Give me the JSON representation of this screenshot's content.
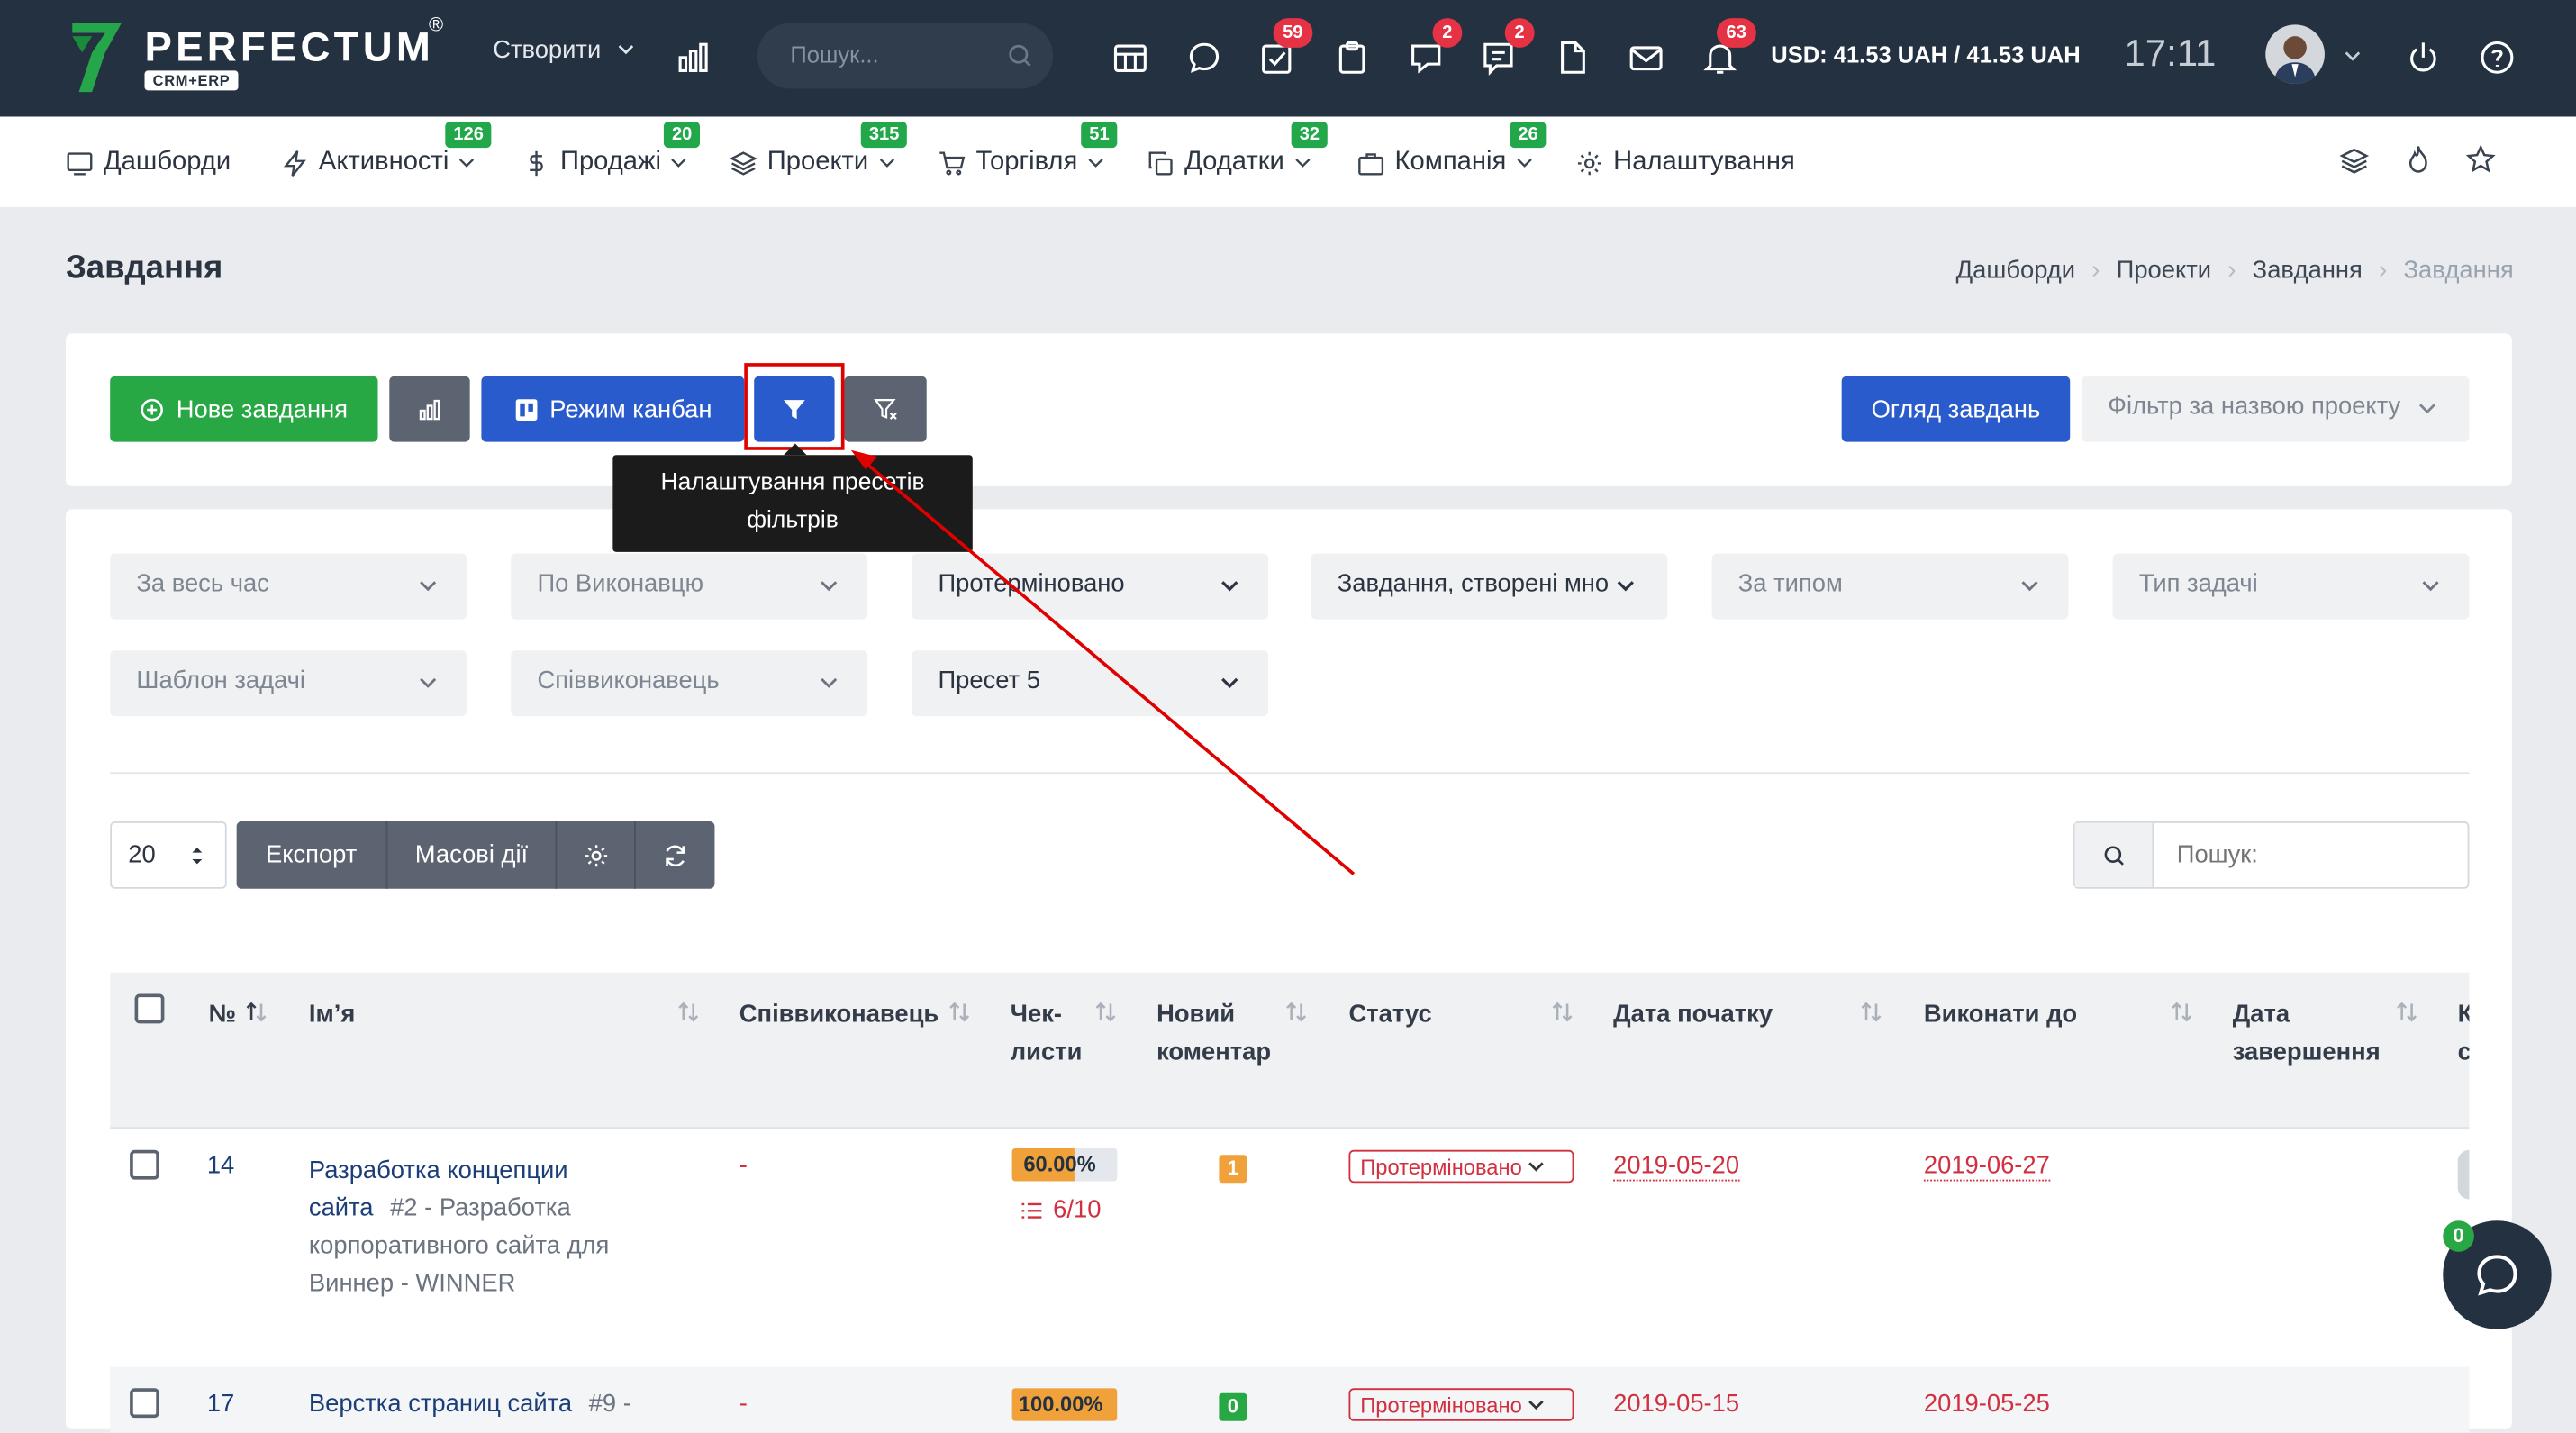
{
  "brand": {
    "name": "PERFECTUM",
    "reg": "®",
    "sub": "CRM+ERP"
  },
  "topbar": {
    "create_label": "Створити",
    "search_placeholder": "Пошук...",
    "badges": {
      "tasks": "59",
      "chat": "2",
      "comments": "2",
      "notifications": "63"
    },
    "currency": "USD: 41.53 UAH / 41.53 UAH",
    "time": "17:11",
    "icons": [
      "stats-icon",
      "search-icon",
      "calendar-icon",
      "chat-icon",
      "tasks-icon",
      "clipboard-icon",
      "chat-bubble-icon",
      "comments-icon",
      "document-icon",
      "mail-icon",
      "bell-icon",
      "power-icon",
      "help-icon"
    ]
  },
  "nav": {
    "items": [
      {
        "label": "Дашборди",
        "badge": ""
      },
      {
        "label": "Активності",
        "badge": "126"
      },
      {
        "label": "Продажі",
        "badge": "20"
      },
      {
        "label": "Проекти",
        "badge": "315"
      },
      {
        "label": "Торгівля",
        "badge": "51"
      },
      {
        "label": "Додатки",
        "badge": "32"
      },
      {
        "label": "Компанія",
        "badge": "26"
      },
      {
        "label": "Налаштування",
        "badge": ""
      }
    ]
  },
  "page": {
    "title": "Завдання",
    "breadcrumb": [
      "Дашборди",
      "Проекти",
      "Завдання",
      "Завдання"
    ]
  },
  "toolbar": {
    "new_task": "Нове завдання",
    "kanban": "Режим канбан",
    "overview": "Огляд завдань",
    "project_filter": "Фільтр за назвою проекту",
    "tooltip": [
      "Налаштування пресетів",
      "фільтрів"
    ]
  },
  "filters": [
    "За весь час",
    "По Виконавцю",
    "Протерміновано",
    "Завдання, створені мно",
    "За типом",
    "Тип задачі",
    "Шаблон задачі",
    "Співвиконавець",
    "Пресет 5"
  ],
  "table_controls": {
    "page_size": "20",
    "export": "Експорт",
    "mass_actions": "Масові дії",
    "search_placeholder": "Пошук:"
  },
  "table": {
    "headers": [
      "№",
      "Ім’я",
      "Співвиконавець",
      [
        "Чек-",
        "листи"
      ],
      [
        "Новий",
        "коментар"
      ],
      "Статус",
      "Дата початку",
      "Виконати до",
      [
        "Дата",
        "завершення"
      ],
      [
        "К",
        "с"
      ]
    ],
    "rows": [
      {
        "id": "14",
        "name_link": [
          "Разработка концепции",
          "сайта"
        ],
        "project": [
          "#2 - Разработка",
          "корпоративного сайта для",
          "Виннер - WINNER"
        ],
        "co": "-",
        "pct": "60.00%",
        "checklist": "6/10",
        "comments": "1",
        "status": "Протерміновано",
        "start": "2019-05-20",
        "due": "2019-06-27"
      },
      {
        "id": "17",
        "name_link": [
          "Верстка страниц сайта"
        ],
        "project": [
          "#9 -"
        ],
        "co": "-",
        "pct": "100.00%",
        "checklist": "",
        "comments": "0",
        "status": "Протерміновано",
        "start": "2019-05-15",
        "due": "2019-05-25"
      }
    ]
  },
  "chat": {
    "badge": "0"
  },
  "colors": {
    "topbar": "#243140",
    "green": "#28a745",
    "blue": "#2a5bcc",
    "red": "#d0303f",
    "annotation": "#e00000"
  }
}
